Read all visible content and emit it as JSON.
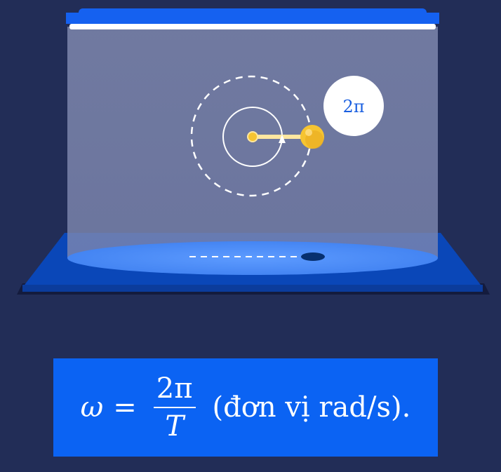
{
  "diagram": {
    "angle_label": "2π",
    "colors": {
      "background": "#222d57",
      "lamp": "#1561f0",
      "light_cone": "#8a93b8",
      "floor_glow": "#4d8ff7",
      "base": "#0a47b8",
      "ball": "#f6c431",
      "formula_bg": "#0b63f3"
    }
  },
  "formula": {
    "lhs": "ω",
    "equals": "=",
    "numerator": "2π",
    "denominator": "T",
    "unit_text": "(đơn vị rad/s)."
  }
}
